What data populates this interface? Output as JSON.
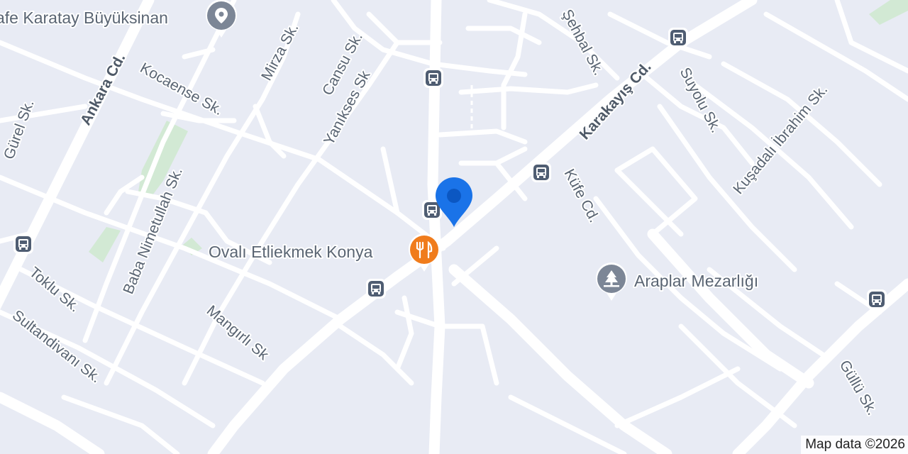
{
  "map": {
    "streets": {
      "sehbal": "Şehbal Sk.",
      "karakayis": "Karakayış Cd.",
      "suyolu": "Suyolu Sk.",
      "kusadali": "Kuşadalı İbrahim Sk.",
      "kufe": "Küfe Cd.",
      "ankara": "Ankara Cd.",
      "kocaense": "Kocaense Sk.",
      "mirza": "Mirza Sk.",
      "cansu": "Cansu Sk.",
      "yanikses": "Yanıkses Sk",
      "gurel": "Gürel Sk.",
      "baba": "Baba Nimetullah Sk.",
      "toklu": "Toklu Sk.",
      "sultandivani": "Sultandivanı Sk.",
      "mangirli": "Mangırlı Sk",
      "gullu": "Güllü Sk."
    },
    "pois": {
      "cafe": {
        "label": "afe Karatay Büyüksinan",
        "icon": "place-pin-icon"
      },
      "restaurant": {
        "label": "Ovalı Etliekmek Konya",
        "icon": "restaurant-icon",
        "color": "#f07c1c"
      },
      "cemetery": {
        "label": "Araplar Mezarlığı",
        "icon": "cemetery-icon"
      }
    },
    "bus_stop_icon": "bus-stop-icon",
    "location_marker": {
      "icon": "location-pin-icon",
      "color": "#1a73e8"
    },
    "colors": {
      "background": "#e8ebf4",
      "road": "#ffffff",
      "park": "#d2e9d4"
    },
    "attribution": "Map data ©2026"
  }
}
